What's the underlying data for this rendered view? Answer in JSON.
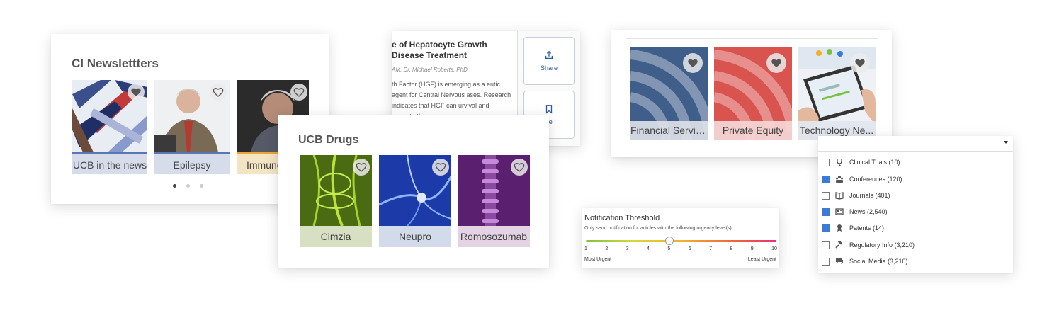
{
  "ci_newsletters": {
    "title": "CI Newslettters",
    "tiles": [
      {
        "label": "UCB in the news",
        "color": "#5a76b3"
      },
      {
        "label": "Epilepsy",
        "color": "#5a76b3"
      },
      {
        "label": "Immuno",
        "color": "#e9a63a"
      }
    ],
    "page_dots": 3,
    "active_dot": 1
  },
  "article": {
    "headline": "e of Hepatocyte Growth Disease Treatment",
    "byline": "AM, Dr. Michael Roberts, PhD",
    "body": "th Factor (HGF) is emerging as a eutic agent for Central Nervous ases. Research indicates that HGF can urvival and promote th",
    "share_label": "Share",
    "save_label": "ve"
  },
  "ucb_drugs": {
    "title": "UCB Drugs",
    "tiles": [
      {
        "label": "Cimzia",
        "color": "#d8e0c3"
      },
      {
        "label": "Neupro",
        "color": "#d2dbea"
      },
      {
        "label": "Romosozumab",
        "color": "#e3d3e4"
      }
    ]
  },
  "topics": {
    "tiles": [
      {
        "label": "Financial Servic...",
        "color": "#3f5f8a"
      },
      {
        "label": "Private Equity",
        "color": "#d9534f"
      },
      {
        "label": "Technology Ne...",
        "color": "#d6dce6"
      }
    ]
  },
  "threshold": {
    "title": "Notification Threshold",
    "subtitle": "Only send notification for articles with the following urgency level(s)",
    "ticks": [
      "1",
      "2",
      "3",
      "4",
      "5",
      "6",
      "7",
      "8",
      "9",
      "10"
    ],
    "value": 5,
    "low_label": "Most Urgent",
    "high_label": "Least Urgent"
  },
  "filter": {
    "items": [
      {
        "label": "Clinical Trials (10)",
        "checked": false,
        "icon": "stethoscope-icon"
      },
      {
        "label": "Conferences (120)",
        "checked": true,
        "icon": "people-icon"
      },
      {
        "label": "Journals (401)",
        "checked": false,
        "icon": "book-icon"
      },
      {
        "label": "News (2,540)",
        "checked": true,
        "icon": "newspaper-icon"
      },
      {
        "label": "Patents (14)",
        "checked": true,
        "icon": "ribbon-icon"
      },
      {
        "label": "Regulatory Info (3,210)",
        "checked": false,
        "icon": "gavel-icon"
      },
      {
        "label": "Social Media (3,210)",
        "checked": false,
        "icon": "chat-icon"
      }
    ]
  }
}
